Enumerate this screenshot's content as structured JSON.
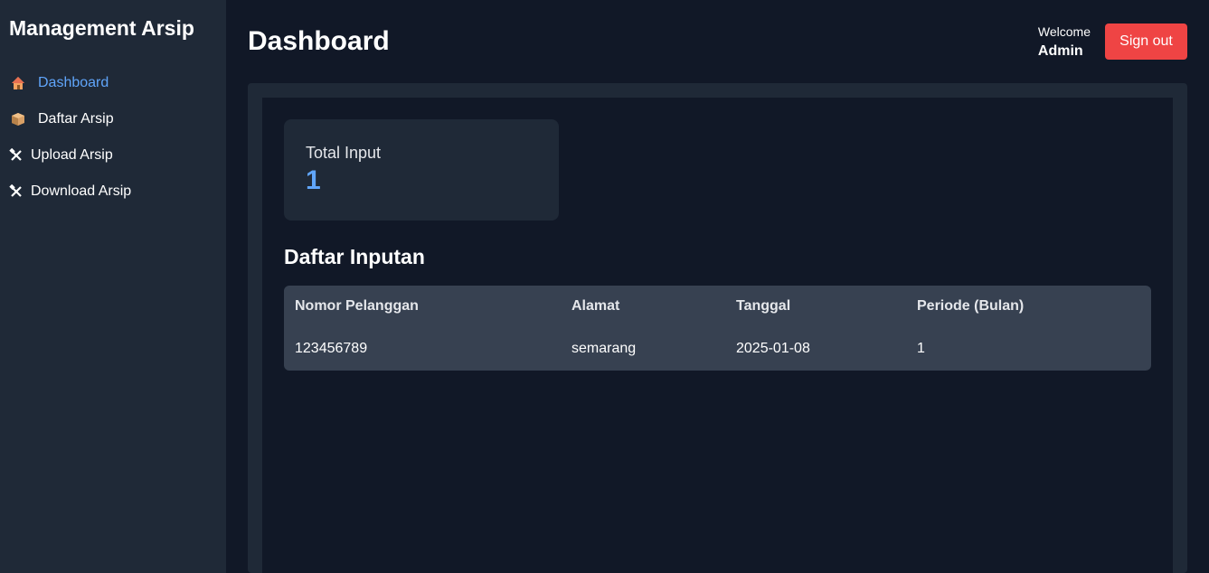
{
  "sidebar": {
    "brand": "Management Arsip",
    "items": [
      {
        "label": "Dashboard",
        "icon": "house-icon",
        "active": true
      },
      {
        "label": "Daftar Arsip",
        "icon": "package-icon",
        "active": false
      },
      {
        "label": "Upload Arsip",
        "icon": "tools-icon",
        "active": false
      },
      {
        "label": "Download Arsip",
        "icon": "tools-icon",
        "active": false
      }
    ]
  },
  "header": {
    "title": "Dashboard",
    "welcome_label": "Welcome",
    "username": "Admin",
    "signout_label": "Sign out"
  },
  "stats": {
    "total_input_label": "Total Input",
    "total_input_value": "1"
  },
  "table": {
    "title": "Daftar Inputan",
    "columns": [
      "Nomor Pelanggan",
      "Alamat",
      "Tanggal",
      "Periode (Bulan)"
    ],
    "rows": [
      [
        "123456789",
        "semarang",
        "2025-01-08",
        "1"
      ]
    ]
  },
  "colors": {
    "background": "#111827",
    "panel": "#1f2937",
    "table": "#374151",
    "accent": "#60a5fa",
    "danger": "#ef4444"
  }
}
